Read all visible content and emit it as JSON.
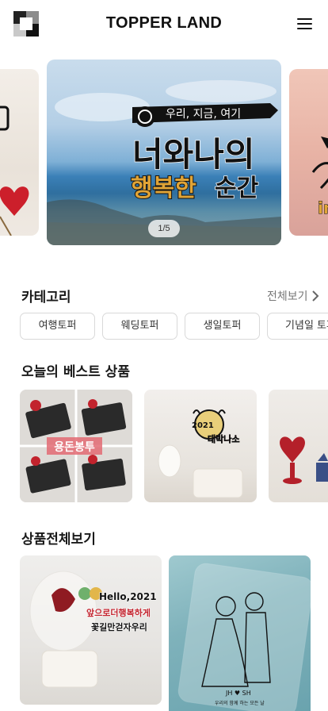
{
  "header": {
    "title": "TOPPER LAND",
    "logo_icon": "checker-logo-icon",
    "menu_icon": "hamburger-menu-icon"
  },
  "carousel": {
    "pager": "1/5",
    "main_slide": {
      "banner_text": "우리, 지금, 여기",
      "line1": "너와나의",
      "line2_highlight": "행복한",
      "line2_rest": "순간"
    },
    "right_slide_text": "in"
  },
  "category": {
    "title": "카테고리",
    "see_all": "전체보기",
    "chips": [
      "여행토퍼",
      "웨딩토퍼",
      "생일토퍼",
      "기념일 토퍼"
    ]
  },
  "best": {
    "title": "오늘의 베스트 상품",
    "p1_label": "용돈봉투",
    "p2_text": "2021",
    "p2_text2": "대박나소"
  },
  "all_products": {
    "title": "상품전체보기",
    "g1_text1": "Hello,2021",
    "g1_text2": "앞으로더행복하게",
    "g1_text3": "꽃길만걷자우리",
    "g2_text1": "JH ♥ SH",
    "g2_text2": "우리의 함께 하는 모든 날"
  },
  "colors": {
    "accent_red": "#d11f2a",
    "gold": "#e0a437",
    "ink": "#111111"
  }
}
